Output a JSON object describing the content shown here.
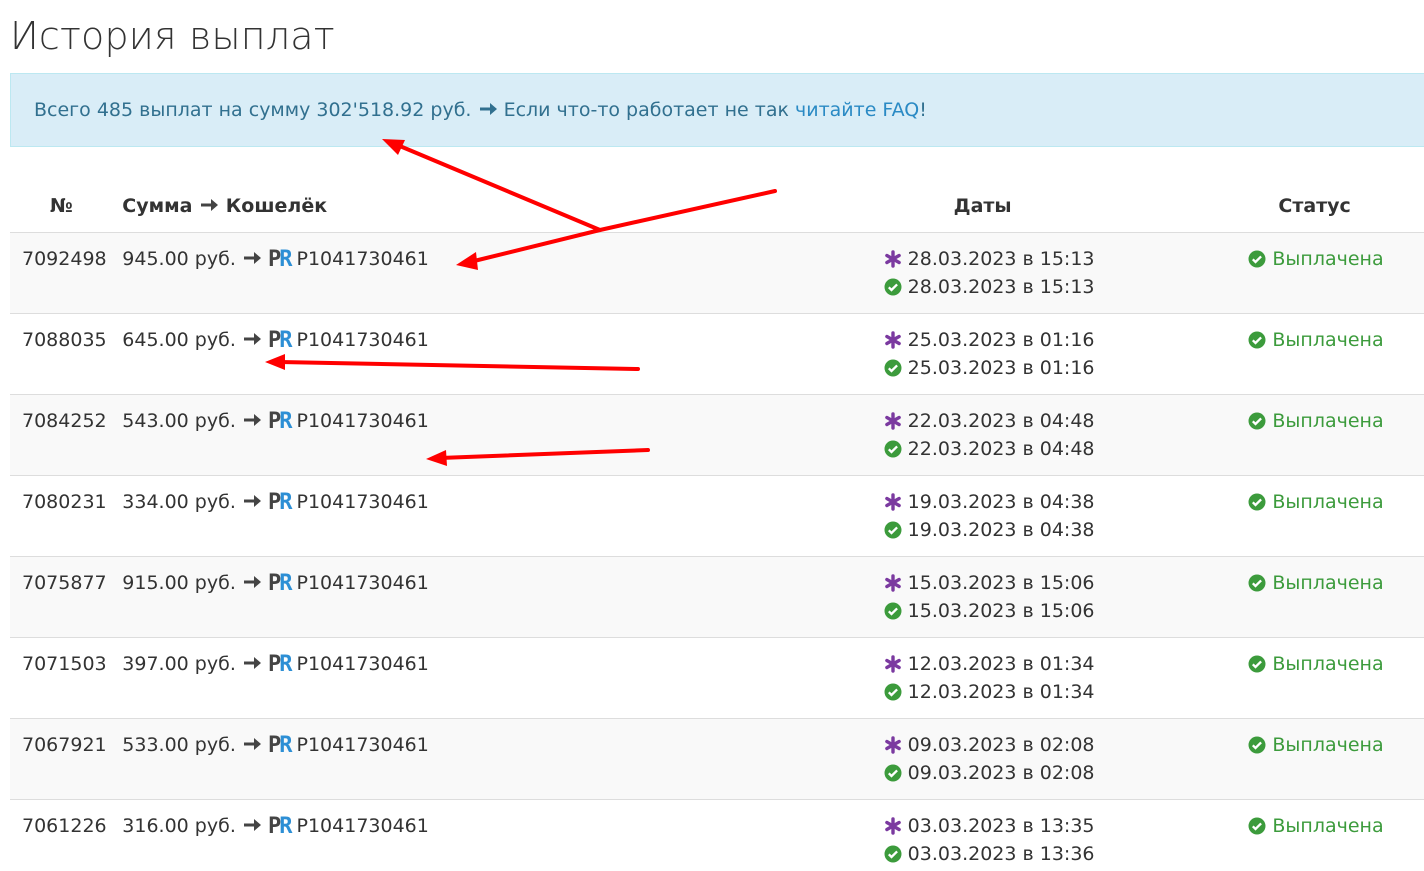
{
  "page": {
    "title": "История выплат"
  },
  "summary": {
    "text_before": "Всего 485 выплат на сумму 302'518.92 руб.",
    "text_after": "Если что-то работает не так",
    "faq_link": "читайте FAQ",
    "suffix": "!"
  },
  "table": {
    "headers": {
      "num": "№",
      "sum": "Сумма",
      "wallet": "Кошелёк",
      "dates": "Даты",
      "status": "Статус"
    },
    "rows": [
      {
        "id": "7092498",
        "amount": "945.00 руб.",
        "wallet": "P1041730461",
        "created": "28.03.2023 в 15:13",
        "paid": "28.03.2023 в 15:13",
        "status": "Выплачена"
      },
      {
        "id": "7088035",
        "amount": "645.00 руб.",
        "wallet": "P1041730461",
        "created": "25.03.2023 в 01:16",
        "paid": "25.03.2023 в 01:16",
        "status": "Выплачена"
      },
      {
        "id": "7084252",
        "amount": "543.00 руб.",
        "wallet": "P1041730461",
        "created": "22.03.2023 в 04:48",
        "paid": "22.03.2023 в 04:48",
        "status": "Выплачена"
      },
      {
        "id": "7080231",
        "amount": "334.00 руб.",
        "wallet": "P1041730461",
        "created": "19.03.2023 в 04:38",
        "paid": "19.03.2023 в 04:38",
        "status": "Выплачена"
      },
      {
        "id": "7075877",
        "amount": "915.00 руб.",
        "wallet": "P1041730461",
        "created": "15.03.2023 в 15:06",
        "paid": "15.03.2023 в 15:06",
        "status": "Выплачена"
      },
      {
        "id": "7071503",
        "amount": "397.00 руб.",
        "wallet": "P1041730461",
        "created": "12.03.2023 в 01:34",
        "paid": "12.03.2023 в 01:34",
        "status": "Выплачена"
      },
      {
        "id": "7067921",
        "amount": "533.00 руб.",
        "wallet": "P1041730461",
        "created": "09.03.2023 в 02:08",
        "paid": "09.03.2023 в 02:08",
        "status": "Выплачена"
      },
      {
        "id": "7061226",
        "amount": "316.00 руб.",
        "wallet": "P1041730461",
        "created": "03.03.2023 в 13:35",
        "paid": "03.03.2023 в 13:36",
        "status": "Выплачена"
      }
    ]
  },
  "payment_system_logo": {
    "letter_1": "P",
    "letter_2": "R"
  },
  "colors": {
    "alert_bg": "#d9edf7",
    "alert_text": "#31708f",
    "link": "#2a8ac4",
    "status_green": "#3c9b3c",
    "asterisk_purple": "#7b3aa0",
    "annotation_red": "#ff0000",
    "stripe": "#f9f9f9"
  },
  "icons": {
    "arrow": "arrow-right-icon",
    "created": "asterisk-icon",
    "paid": "check-circle-icon",
    "status": "check-circle-icon"
  }
}
